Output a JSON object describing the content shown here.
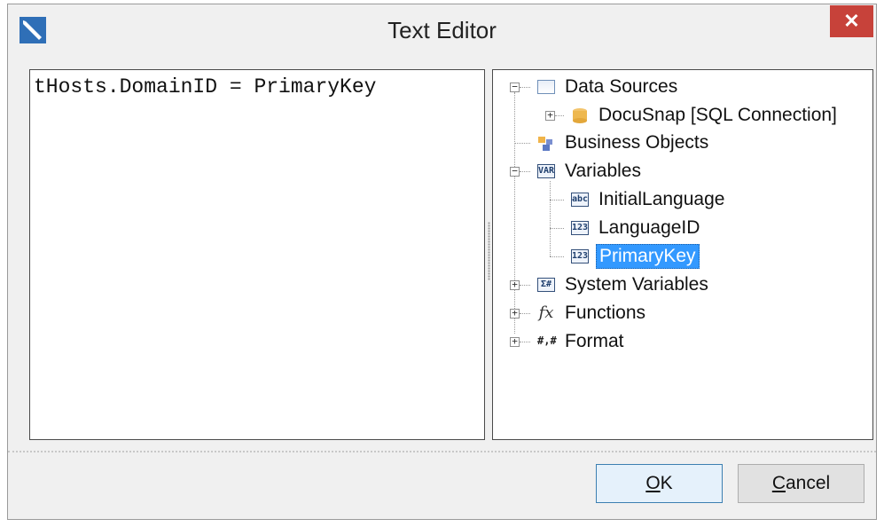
{
  "window": {
    "title": "Text Editor",
    "close_glyph": "✕"
  },
  "editor": {
    "text": "tHosts.DomainID = PrimaryKey"
  },
  "tree": {
    "items": [
      {
        "label": "Data Sources",
        "icon": "data-sources-icon"
      },
      {
        "label": "DocuSnap [SQL Connection]",
        "icon": "database-icon"
      },
      {
        "label": "Business Objects",
        "icon": "business-objects-icon"
      },
      {
        "label": "Variables",
        "icon": "variables-icon",
        "icon_text": "VAR"
      },
      {
        "label": "InitialLanguage",
        "icon": "string-variable-icon",
        "icon_text": "abc"
      },
      {
        "label": "LanguageID",
        "icon": "number-variable-icon",
        "icon_text": "123"
      },
      {
        "label": "PrimaryKey",
        "icon": "number-variable-icon",
        "icon_text": "123",
        "selected": true
      },
      {
        "label": "System Variables",
        "icon": "system-variables-icon",
        "icon_text": "Σ#"
      },
      {
        "label": "Functions",
        "icon": "function-icon",
        "icon_text": "fx"
      },
      {
        "label": "Format",
        "icon": "format-icon",
        "icon_text": "#,#"
      }
    ]
  },
  "buttons": {
    "ok": {
      "label_mnemonic": "O",
      "label_rest": "K"
    },
    "cancel": {
      "label_mnemonic": "C",
      "label_rest": "ancel"
    }
  },
  "colors": {
    "selection": "#3399ff",
    "close": "#c7423a",
    "app_icon": "#2f6fb7"
  }
}
